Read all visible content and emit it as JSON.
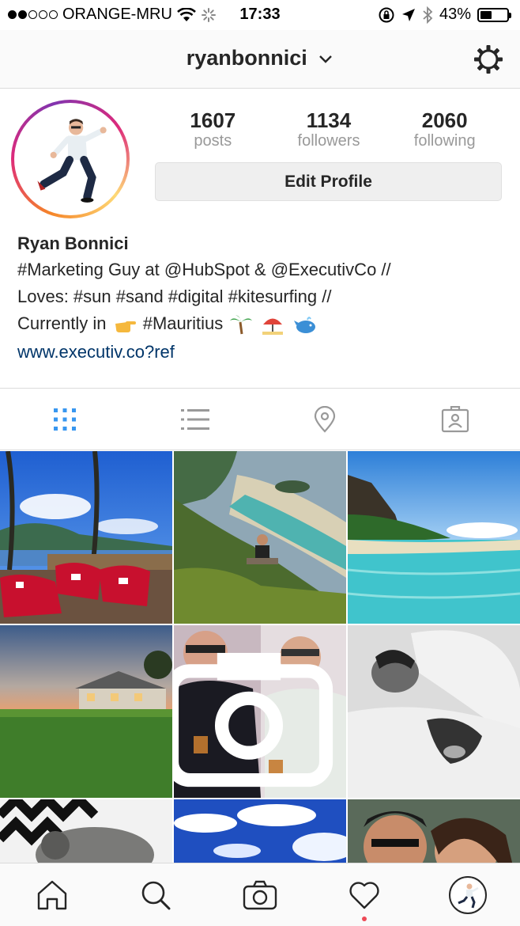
{
  "status_bar": {
    "carrier": "ORANGE-MRU",
    "time": "17:33",
    "battery_percent": "43%",
    "battery_level": 0.43,
    "signal_bars_filled": 2,
    "signal_bars_total": 5
  },
  "nav": {
    "username": "ryanbonnici",
    "icons": [
      "chevron-down-icon",
      "gear-icon"
    ]
  },
  "profile": {
    "stats": {
      "posts_count": "1607",
      "posts_label": "posts",
      "followers_count": "1134",
      "followers_label": "followers",
      "following_count": "2060",
      "following_label": "following"
    },
    "edit_button_label": "Edit Profile",
    "name": "Ryan Bonnici",
    "bio_line1": "#Marketing Guy at @HubSpot & @ExecutivCo //",
    "bio_line2": "Loves: #sun #sand #digital #kitesurfing //",
    "bio_line3_prefix": "Currently in",
    "bio_line3_tag": "#Mauritius",
    "website": "www.executiv.co?ref"
  },
  "tabs": [
    "grid-icon",
    "list-icon",
    "location-pin-icon",
    "tagged-icon"
  ],
  "active_tab": "grid",
  "grid": [
    "beach-beanbags-photo",
    "mountain-lagoon-photo",
    "tropical-beach-photo",
    "house-lawn-photo",
    "friends-video-thumbnail",
    "sleeping-dog-photo",
    "pattern-cat-photo",
    "blue-sky-photo",
    "couple-selfie-photo"
  ],
  "bottom_bar": [
    "home-icon",
    "search-icon",
    "camera-icon",
    "heart-icon",
    "profile-avatar"
  ],
  "colors": {
    "link": "#003569",
    "active_tab": "#3897f0",
    "notification_dot": "#ed4956"
  }
}
